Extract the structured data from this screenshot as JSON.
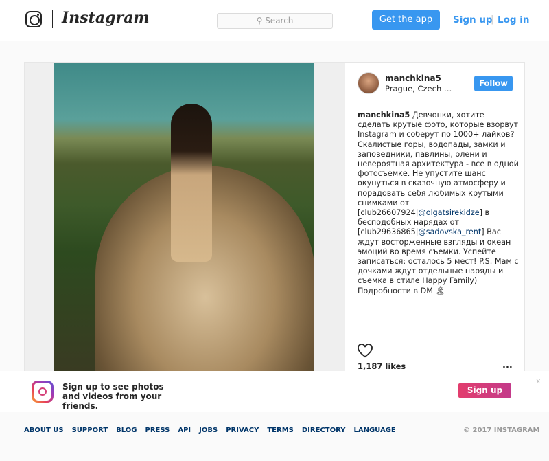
{
  "header": {
    "brand": "Instagram",
    "search_placeholder": "Search",
    "get_app": "Get the app",
    "sign_up": "Sign up",
    "log_in": "Log in"
  },
  "post": {
    "username": "manchkina5",
    "location": "Prague, Czech Republic",
    "follow": "Follow",
    "caption_user": "manchkina5",
    "caption_1": " Девчонки, хотите сделать крутые фото, которые взорвут Instagram и соберут по 1000+ лайков? Скалистые горы, водопады, замки и заповедники, павлины, олени и невероятная архитектура - все в одной фотосъемке. Не упустите шанс окунуться в сказочную атмосферу и порадовать себя любимых крутыми снимками от [club26607924|",
    "mention_1": "@olgatsirekidze",
    "caption_2": "] в бесподобных нарядах от [club29636865|",
    "mention_2": "@sadovska_rent",
    "caption_3": "] Вас ждут восторженные взгляды и океан эмоций во время съемки. Успейте записаться: осталось 5 мест! P.S. Мам с дочками ждут отдельные наряды и съемка в стиле Happy Family) Подробности в DM 🏝",
    "likes": "1,187 likes",
    "more": "..."
  },
  "banner": {
    "text": "Sign up to see photos and videos from your friends.",
    "sign_up": "Sign up",
    "close": "x"
  },
  "footer": {
    "links": [
      "ABOUT US",
      "SUPPORT",
      "BLOG",
      "PRESS",
      "API",
      "JOBS",
      "PRIVACY",
      "TERMS",
      "DIRECTORY",
      "LANGUAGE"
    ],
    "copyright": "© 2017 INSTAGRAM"
  }
}
